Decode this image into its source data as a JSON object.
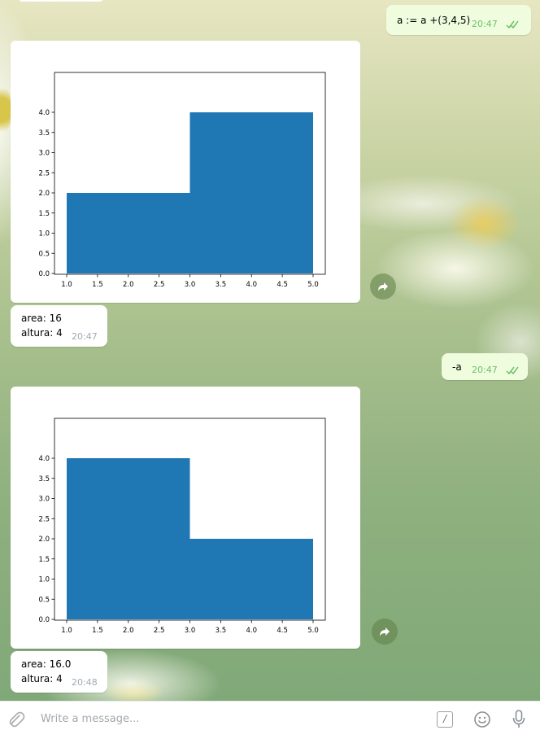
{
  "messages": [
    {
      "id": "m1",
      "direction": "out",
      "text": "a := a +(3,4,5)",
      "time": "20:47",
      "read": true
    },
    {
      "id": "m2",
      "direction": "in",
      "type": "photo",
      "chart_index": 0
    },
    {
      "id": "m3",
      "direction": "in",
      "lines": [
        "area: 16",
        "altura: 4"
      ],
      "time": "20:47"
    },
    {
      "id": "m4",
      "direction": "out",
      "text": "-a",
      "time": "20:47",
      "read": true
    },
    {
      "id": "m5",
      "direction": "in",
      "type": "photo",
      "chart_index": 1
    },
    {
      "id": "m6",
      "direction": "in",
      "lines": [
        "area: 16.0",
        "altura: 4"
      ],
      "time": "20:48"
    }
  ],
  "chart_data": [
    {
      "type": "area",
      "step": "post",
      "x": [
        1.0,
        3.0,
        5.0
      ],
      "y": [
        2,
        4,
        4
      ],
      "xlim": [
        1.0,
        5.0
      ],
      "ylim": [
        0.0,
        4.0
      ],
      "x_ticks": [
        "1.0",
        "1.5",
        "2.0",
        "2.5",
        "3.0",
        "3.5",
        "4.0",
        "4.5",
        "5.0"
      ],
      "y_ticks": [
        "0.0",
        "0.5",
        "1.0",
        "1.5",
        "2.0",
        "2.5",
        "3.0",
        "3.5",
        "4.0"
      ],
      "title": "",
      "xlabel": "",
      "ylabel": "",
      "color": "#1f77b4",
      "grid": false
    },
    {
      "type": "area",
      "step": "post",
      "x": [
        1.0,
        3.0,
        5.0
      ],
      "y": [
        4,
        2,
        2
      ],
      "xlim": [
        1.0,
        5.0
      ],
      "ylim": [
        0.0,
        4.0
      ],
      "x_ticks": [
        "1.0",
        "1.5",
        "2.0",
        "2.5",
        "3.0",
        "3.5",
        "4.0",
        "4.5",
        "5.0"
      ],
      "y_ticks": [
        "0.0",
        "0.5",
        "1.0",
        "1.5",
        "2.0",
        "2.5",
        "3.0",
        "3.5",
        "4.0"
      ],
      "title": "",
      "xlabel": "",
      "ylabel": "",
      "color": "#1f77b4",
      "grid": false
    }
  ],
  "composer": {
    "placeholder": "Write a message..."
  },
  "icons": {
    "attach": "paperclip-icon",
    "commands": "slash-command-icon",
    "emoji": "emoji-icon",
    "voice": "microphone-icon",
    "share": "share-arrow-icon",
    "read": "double-check-icon"
  },
  "colors": {
    "outgoing_bubble": "#effdde",
    "incoming_bubble": "#ffffff",
    "outgoing_time": "#6dbf67",
    "incoming_time": "#a1aab3",
    "chart_fill": "#1f77b4"
  }
}
